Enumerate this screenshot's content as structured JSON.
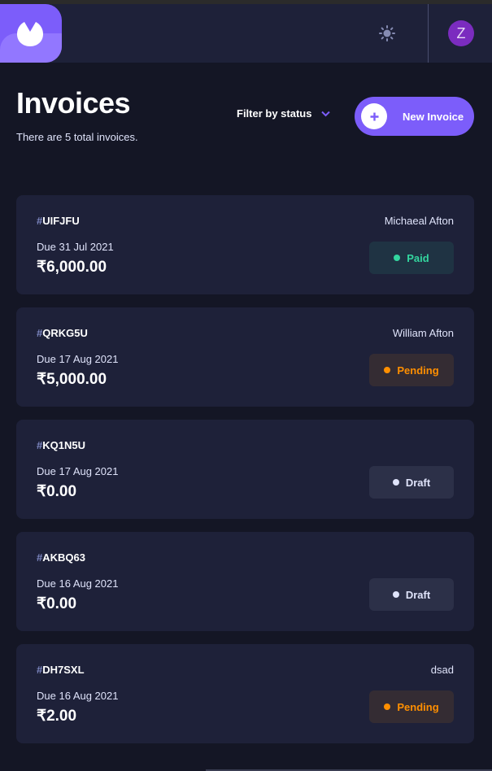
{
  "header": {
    "logo_icon": "app-logo-icon",
    "theme_icon": "sun-icon",
    "avatar_initial": "Z",
    "avatar_color": "#7b2cbf"
  },
  "page": {
    "title": "Invoices",
    "subtitle": "There are 5 total invoices.",
    "filter_label": "Filter by status",
    "new_invoice_label": "New Invoice"
  },
  "invoices": [
    {
      "hash": "#",
      "id": "UIFJFU",
      "client": "Michaeal Afton",
      "due": "Due 31 Jul 2021",
      "amount": "₹6,000.00",
      "status": "Paid"
    },
    {
      "hash": "#",
      "id": "QRKG5U",
      "client": "William Afton",
      "due": "Due 17 Aug 2021",
      "amount": "₹5,000.00",
      "status": "Pending"
    },
    {
      "hash": "#",
      "id": "KQ1N5U",
      "client": "",
      "due": "Due 17 Aug 2021",
      "amount": "₹0.00",
      "status": "Draft"
    },
    {
      "hash": "#",
      "id": "AKBQ63",
      "client": "",
      "due": "Due 16 Aug 2021",
      "amount": "₹0.00",
      "status": "Draft"
    },
    {
      "hash": "#",
      "id": "DH7SXL",
      "client": "dsad",
      "due": "Due 16 Aug 2021",
      "amount": "₹2.00",
      "status": "Pending"
    }
  ],
  "colors": {
    "accent": "#7c5dfa",
    "paid": "#33d69f",
    "pending": "#ff8f00",
    "draft": "#dfe3fa"
  }
}
